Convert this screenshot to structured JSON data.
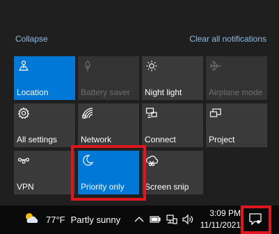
{
  "action_center": {
    "collapse_label": "Collapse",
    "clear_all_label": "Clear all notifications",
    "tiles": [
      {
        "label": "Location",
        "icon": "location-icon",
        "state": "on"
      },
      {
        "label": "Battery saver",
        "icon": "battery-saver-icon",
        "state": "disabled"
      },
      {
        "label": "Night light",
        "icon": "night-light-icon",
        "state": "off"
      },
      {
        "label": "Airplane mode",
        "icon": "airplane-icon",
        "state": "disabled"
      },
      {
        "label": "All settings",
        "icon": "gear-icon",
        "state": "off"
      },
      {
        "label": "Network",
        "icon": "network-icon",
        "state": "off"
      },
      {
        "label": "Connect",
        "icon": "connect-icon",
        "state": "off"
      },
      {
        "label": "Project",
        "icon": "project-icon",
        "state": "off"
      },
      {
        "label": "VPN",
        "icon": "vpn-icon",
        "state": "off"
      },
      {
        "label": "Priority only",
        "icon": "moon-icon",
        "state": "on"
      },
      {
        "label": "Screen snip",
        "icon": "screen-snip-icon",
        "state": "off"
      }
    ]
  },
  "taskbar": {
    "weather_temp": "77°F",
    "weather_condition": "Partly sunny",
    "weather_icon": "partly-sunny-icon",
    "time": "3:09 PM",
    "date": "11/11/2021",
    "tray_icons": [
      "chevron-up-icon",
      "battery-icon",
      "network-icon",
      "volume-icon"
    ],
    "notification_icon": "notification-icon"
  },
  "colors": {
    "accent": "#0078d7",
    "tile": "#3a3a3a",
    "background": "#1f1f1f",
    "taskbar": "#0a0a0a",
    "highlight": "#e0161e",
    "link": "#8fbce8"
  }
}
